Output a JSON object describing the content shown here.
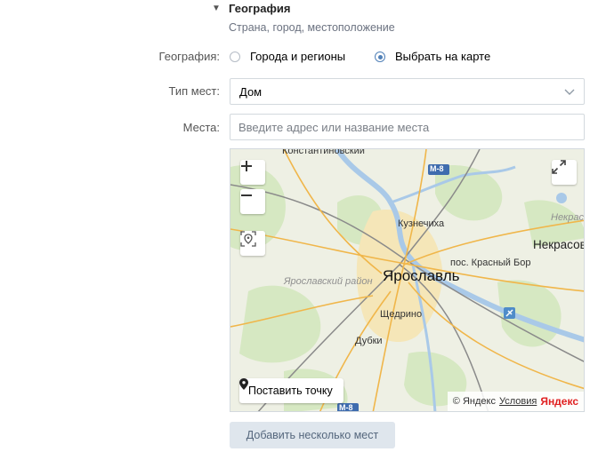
{
  "section": {
    "title": "География",
    "subtitle": "Страна, город, местоположение"
  },
  "geography_row": {
    "label": "География:",
    "options": [
      "Города и регионы",
      "Выбрать на карте"
    ],
    "selected": "Выбрать на карте"
  },
  "place_type": {
    "label": "Тип мест:",
    "value": "Дом"
  },
  "places": {
    "label": "Места:",
    "placeholder": "Введите адрес или название места"
  },
  "map": {
    "labels": {
      "konstantinovsky": "Константиновский",
      "m8_top": "М-8",
      "m8_bottom": "М-8",
      "kuznechikha": "Кузнечиха",
      "nekrasovskoye": "Некрасов",
      "nekrasovskoye_italic": "Некрас",
      "krasny_bor": "пос. Красный Бор",
      "yaroslavl": "Ярославль",
      "yaroslavsky_rayon": "Ярославский район",
      "shchedrino": "Щедрино",
      "dubki": "Дубки"
    },
    "place_point_label": "Поставить точку",
    "copyright": "© Яндекс",
    "terms_link": "Условия",
    "logo": "Яндекс",
    "colors": {
      "road": "#f0b64a",
      "water": "#a9c9e8",
      "forest": "#d6e8c2",
      "city": "#f5e6b8",
      "rail": "#8a8a8a"
    }
  },
  "add_button": {
    "label": "Добавить несколько мест"
  }
}
